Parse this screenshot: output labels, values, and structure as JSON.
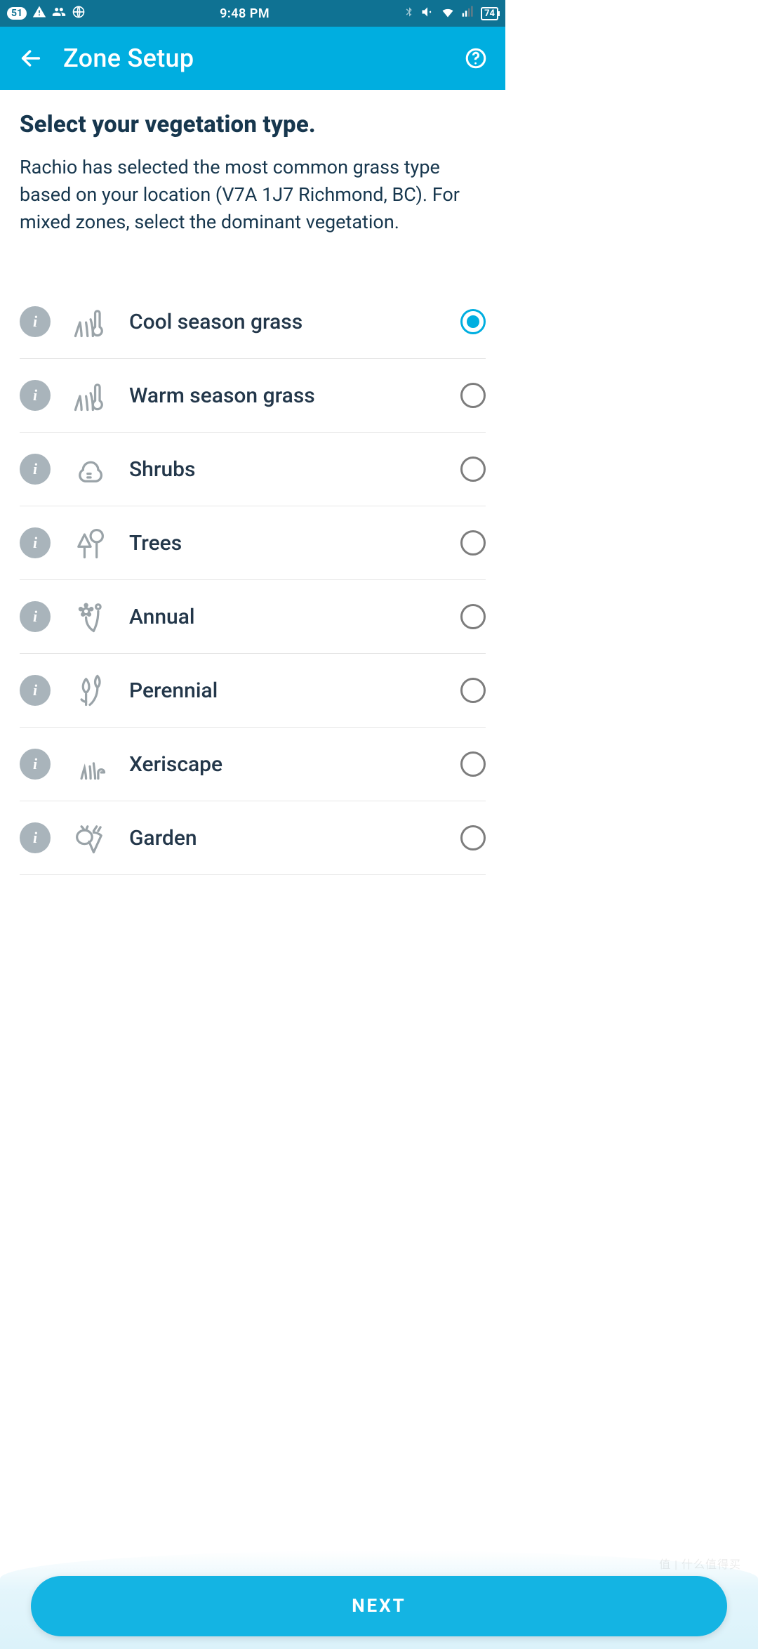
{
  "status_bar": {
    "notif_count": "51",
    "clock": "9:48 PM",
    "battery": "74"
  },
  "app_bar": {
    "title": "Zone Setup"
  },
  "page": {
    "headline": "Select your vegetation type.",
    "subtext": "Rachio has selected the most common grass type based on your location (V7A 1J7 Richmond, BC). For mixed zones, select the dominant vegetation."
  },
  "options": [
    {
      "label": "Cool season grass",
      "selected": true,
      "icon": "grass-thermo-icon"
    },
    {
      "label": "Warm season grass",
      "selected": false,
      "icon": "grass-thermo-icon"
    },
    {
      "label": "Shrubs",
      "selected": false,
      "icon": "shrub-icon"
    },
    {
      "label": "Trees",
      "selected": false,
      "icon": "trees-icon"
    },
    {
      "label": "Annual",
      "selected": false,
      "icon": "flower-icon"
    },
    {
      "label": "Perennial",
      "selected": false,
      "icon": "tulip-icon"
    },
    {
      "label": "Xeriscape",
      "selected": false,
      "icon": "cactus-icon"
    },
    {
      "label": "Garden",
      "selected": false,
      "icon": "carrot-icon"
    }
  ],
  "footer": {
    "next_label": "NEXT"
  },
  "watermark": "值 | 什么值得买"
}
